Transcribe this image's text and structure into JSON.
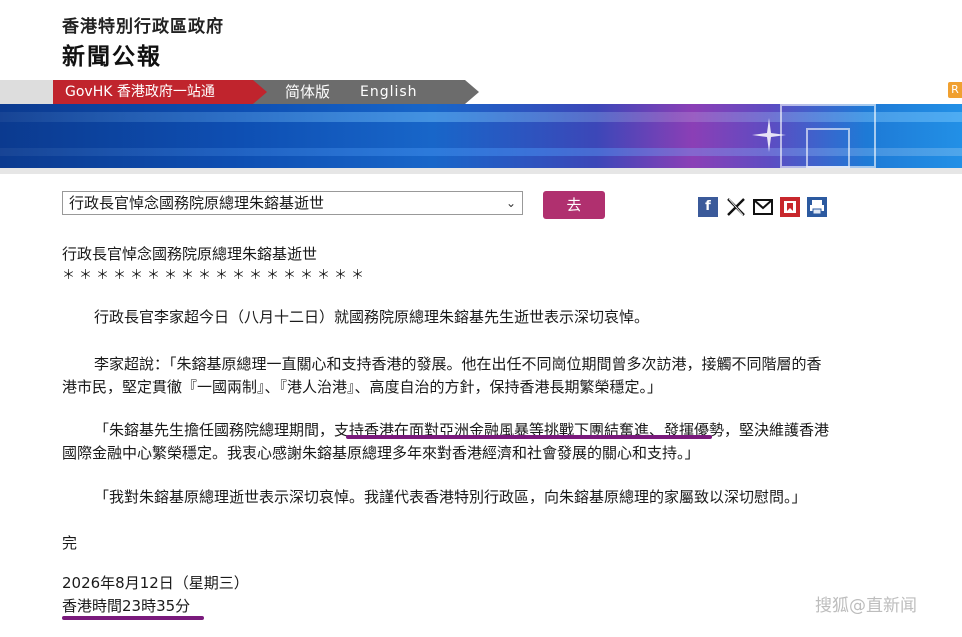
{
  "header": {
    "title": "香港特別行政區政府",
    "subtitle": "新聞公報"
  },
  "nav": {
    "govhk": "GovHK 香港政府一站通",
    "simplified": "简体版",
    "english": "English"
  },
  "toolbar": {
    "select_value": "行政長官悼念國務院原總理朱鎔基逝世",
    "go_label": "去",
    "share_icons": [
      "facebook-icon",
      "x-icon",
      "mail-icon",
      "bookmark-icon",
      "print-icon"
    ]
  },
  "article": {
    "title": "行政長官悼念國務院原總理朱鎔基逝世",
    "stars": "＊＊＊＊＊＊＊＊＊＊＊＊＊＊＊＊＊＊",
    "para1": "行政長官李家超今日（八月十二日）就國務院原總理朱鎔基先生逝世表示深切哀悼。",
    "para2_line1": "李家超說：「朱鎔基原總理一直關心和支持香港的發展。他在出任不同崗位期間曾多次訪港，接觸不同階層的香",
    "para2_line2": "港市民，堅定貫徹『一國兩制』、『港人治港』、高度自治的方針，保持香港長期繁榮穩定。」",
    "para3_line1": "「朱鎔基先生擔任國務院總理期間，支持香港在面對亞洲金融風暴等挑戰下團結奮進、發揮優勢，堅決維護香港",
    "para3_line2": "國際金融中心繁榮穩定。我衷心感謝朱鎔基原總理多年來對香港經濟和社會發展的關心和支持。」",
    "para4": "「我對朱鎔基原總理逝世表示深切哀悼。我謹代表香港特別行政區，向朱鎔基原總理的家屬致以深切慰問。」",
    "end": "完",
    "date": "2026年8月12日（星期三）",
    "time": "香港時間23時35分"
  },
  "watermark": "搜狐@直新闻",
  "colors": {
    "govhk_red": "#c0242d",
    "nav_grey": "#6c6c6c",
    "go_button": "#b0306f",
    "highlight_underline": "#7a1a7c"
  }
}
